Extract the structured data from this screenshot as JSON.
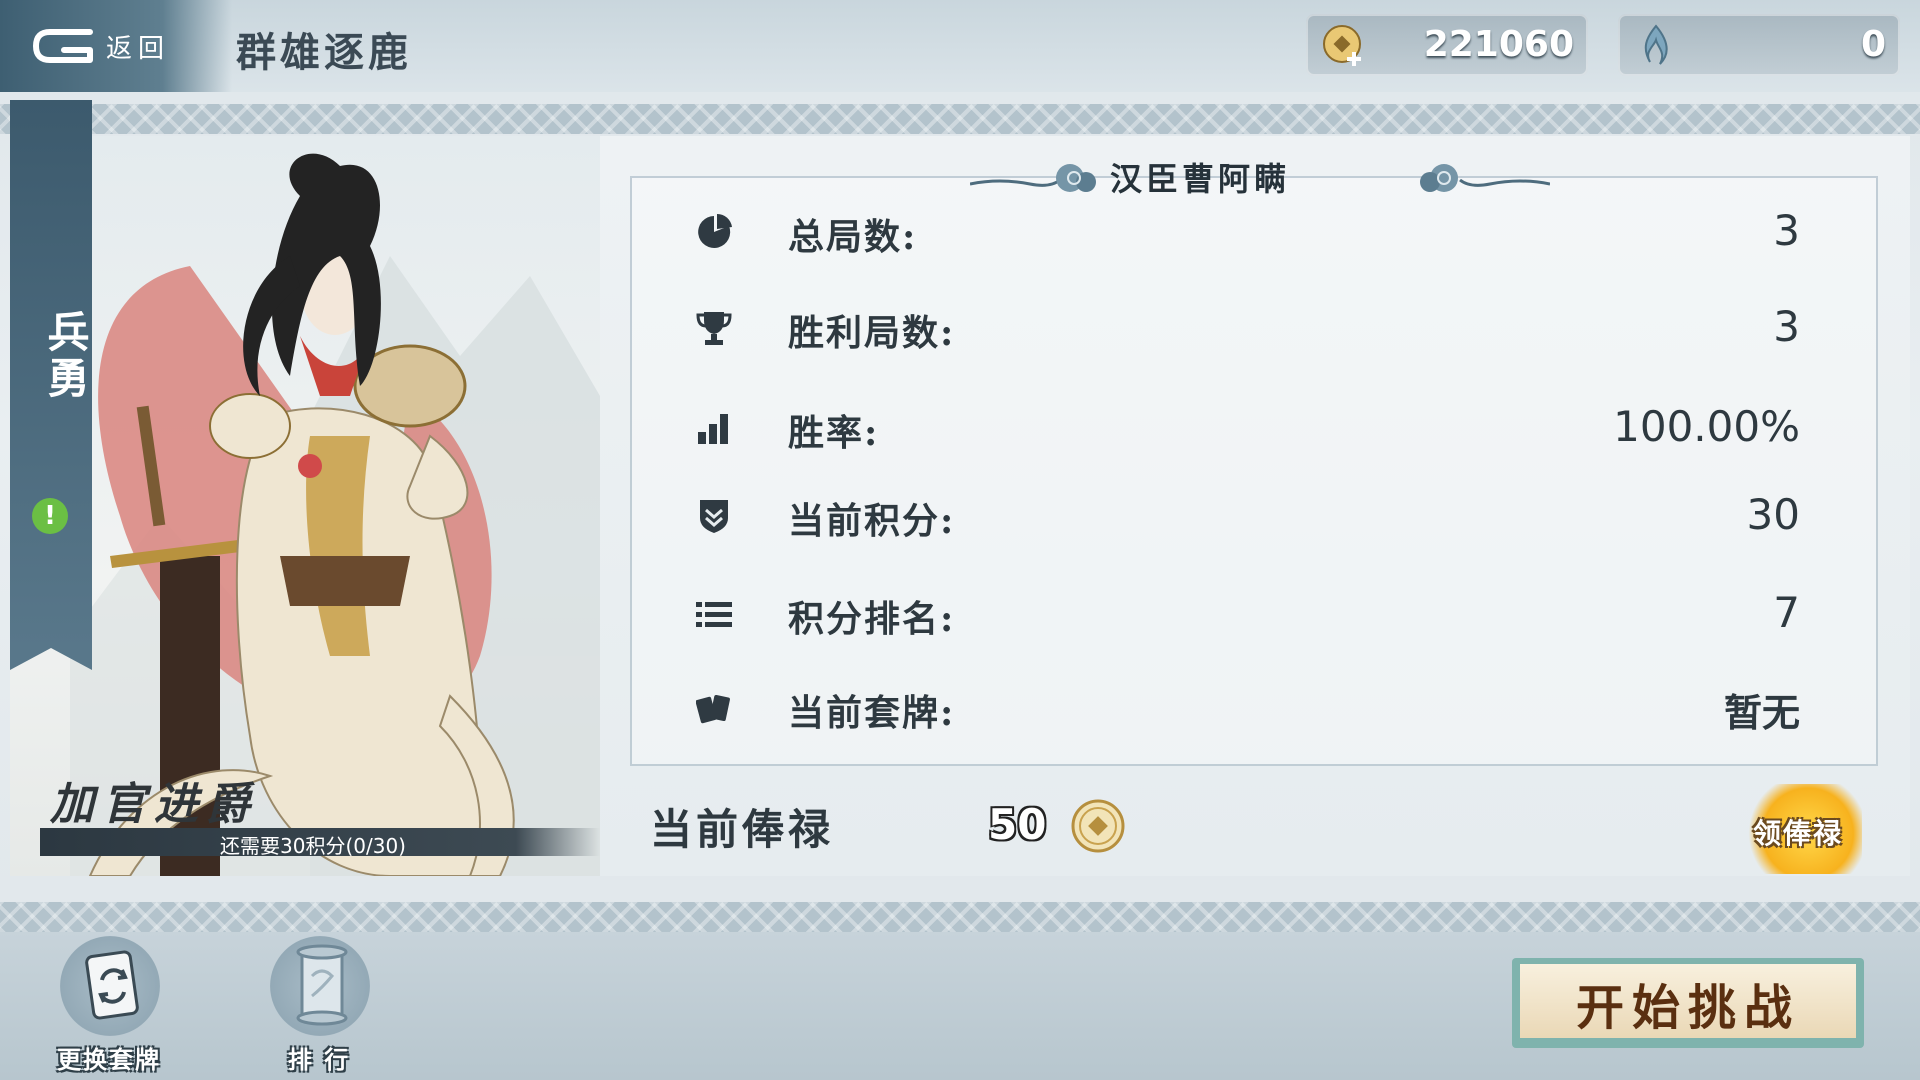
{
  "header": {
    "back_label": "返回",
    "title": "群雄逐鹿",
    "coins": "221060",
    "jade": "0"
  },
  "hero": {
    "rank": "兵勇",
    "promotion_title": "加官进爵",
    "promotion_progress_text": "还需要30积分(0/30)",
    "promotion_progress": 0
  },
  "stats": {
    "player_name": "汉臣曹阿瞒",
    "rows": [
      {
        "icon": "pie-chart-icon",
        "label": "总局数:",
        "value": "3"
      },
      {
        "icon": "trophy-icon",
        "label": "胜利局数:",
        "value": "3"
      },
      {
        "icon": "bar-chart-icon",
        "label": "胜率:",
        "value": "100.00%"
      },
      {
        "icon": "shield-icon",
        "label": "当前积分:",
        "value": "30"
      },
      {
        "icon": "list-icon",
        "label": "积分排名:",
        "value": "7"
      },
      {
        "icon": "cards-icon",
        "label": "当前套牌:",
        "value": "暂无"
      }
    ]
  },
  "salary": {
    "label": "当前俸禄",
    "value": "50",
    "claim_label": "领俸禄"
  },
  "bottom": {
    "change_deck_label": "更换套牌",
    "ranking_label": "排 行",
    "start_label": "开始挑战"
  },
  "colors": {
    "accent_dark": "#3e5f72",
    "salary_gold": "#f7b21e",
    "start_button_frame": "#7fb3ad"
  }
}
